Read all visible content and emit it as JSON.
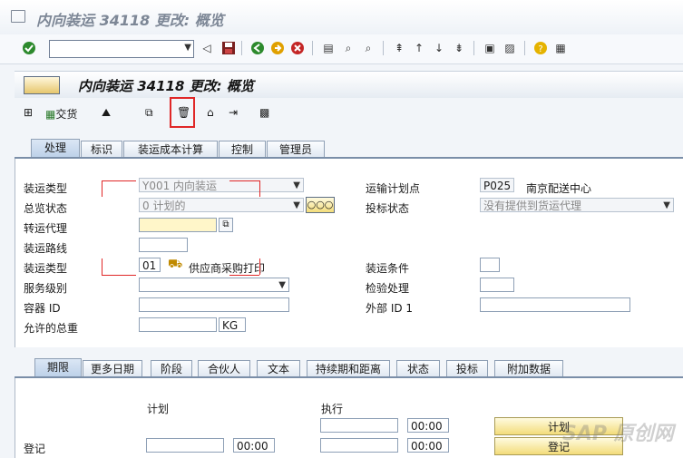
{
  "window": {
    "title": "内向装运 34118 更改: 概览"
  },
  "system_toolbar": {
    "command_value": ""
  },
  "app": {
    "title": "内向装运 34118 更改: 概览"
  },
  "app_toolbar": {
    "trade_label": "交货"
  },
  "tabs": [
    "处理",
    "标识",
    "装运成本计算",
    "控制",
    "管理员"
  ],
  "form": {
    "shipment_type_label": "装运类型",
    "shipment_type_value": "Y001 内向装运",
    "overall_status_label": "总览状态",
    "overall_status_value": "0 计划的",
    "forwarding_agent_label": "转运代理",
    "route_label": "装运路线",
    "shipment_type2_label": "装运类型",
    "shipment_type2_code": "01",
    "shipment_type2_text": "供应商采购打印",
    "service_level_label": "服务级别",
    "container_id_label": "容器 ID",
    "allowed_weight_label": "允许的总重",
    "weight_unit": "KG",
    "transport_plan_point_label": "运输计划点",
    "transport_plan_point_code": "P025",
    "transport_plan_point_text": "南京配送中心",
    "tender_status_label": "投标状态",
    "tender_status_value": "没有提供到货运代理",
    "shipment_cond_label": "装运条件",
    "inspection_label": "检验处理",
    "external_id_label": "外部 ID 1"
  },
  "lower_tabs": [
    "期限",
    "更多日期",
    "阶段",
    "合伙人",
    "文本",
    "持续期和距离",
    "状态",
    "投标",
    "附加数据"
  ],
  "deadlines": {
    "plan_label": "计划",
    "exec_label": "执行",
    "checkin_label": "登记",
    "time1": "00:00",
    "time2": "00:00",
    "time3": "00:00",
    "plan_button": "计划",
    "checkin_button": "登记"
  },
  "watermark": "SAP 原创网"
}
